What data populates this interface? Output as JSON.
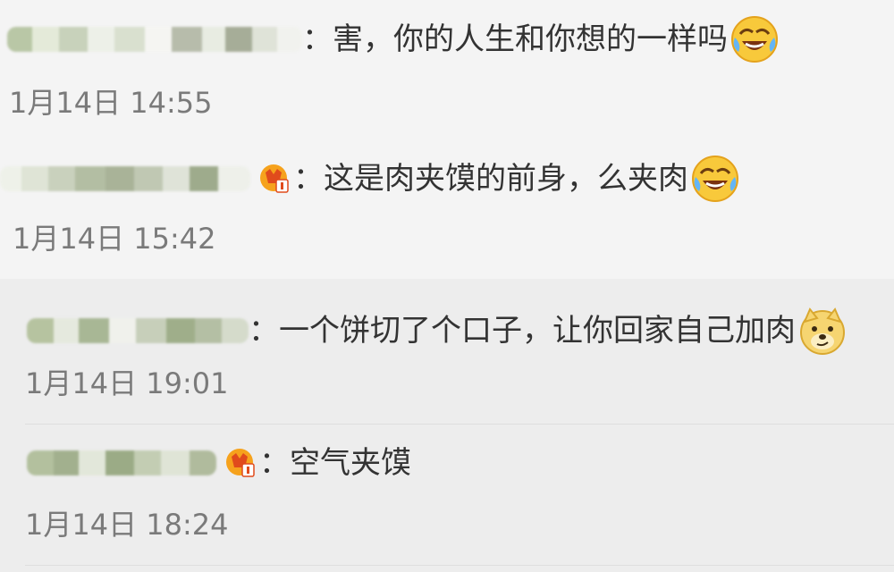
{
  "comments": [
    {
      "text": "：害，你的人生和你想的一样吗",
      "emoji": "laugh-cry-emoji",
      "time": "1月14日 14:55"
    },
    {
      "text": "：这是肉夹馍的前身，么夹肉",
      "badge": "vip-badge-icon",
      "emoji": "laugh-cry-emoji",
      "time": "1月14日 15:42"
    }
  ],
  "replies": [
    {
      "text": "：一个饼切了个口子，让你回家自己加肉",
      "emoji": "doge-emoji",
      "time": "1月14日 19:01"
    },
    {
      "text": "：空气夹馍",
      "badge": "vip-badge-icon",
      "time": "1月14日 18:24"
    }
  ]
}
